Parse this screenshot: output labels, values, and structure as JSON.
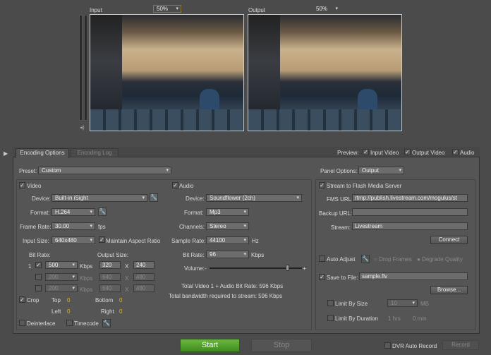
{
  "preview": {
    "input_label": "Input",
    "input_zoom": "50%",
    "output_label": "Output",
    "output_zoom": "50%"
  },
  "tabs": [
    {
      "label": "Encoding Options",
      "active": true
    },
    {
      "label": "Encoding Log",
      "active": false
    }
  ],
  "preview_opts": {
    "label": "Preview:",
    "input_video": "Input Video",
    "output_video": "Output Video",
    "audio": "Audio"
  },
  "preset": {
    "label": "Preset:",
    "value": "Custom"
  },
  "panel_options": {
    "label": "Panel Options:",
    "value": "Output"
  },
  "video": {
    "label": "Video",
    "device_label": "Device:",
    "device": "Built-in iSight",
    "format_label": "Format:",
    "format": "H.264",
    "frame_rate_label": "Frame Rate:",
    "frame_rate": "30.00",
    "fps": "fps",
    "input_size_label": "Input Size:",
    "input_size": "640x480",
    "maintain_aspect": "Maintain Aspect Ratio",
    "bit_rate_label": "Bit Rate:",
    "output_size_label": "Output Size:",
    "rows": [
      {
        "num": "1",
        "rate": "500",
        "unit": "Kbps",
        "w": "320",
        "x": "X",
        "h": "240"
      },
      {
        "rate": "200",
        "unit": "Kbps",
        "w": "640",
        "x": "X",
        "h": "480"
      },
      {
        "rate": "200",
        "unit": "Kbps",
        "w": "640",
        "x": "X",
        "h": "480"
      }
    ],
    "crop": "Crop",
    "top": "Top",
    "top_v": "0",
    "bottom": "Bottom",
    "bottom_v": "0",
    "left": "Left",
    "left_v": "0",
    "right": "Right",
    "right_v": "0",
    "deinterlace": "Deinterlace",
    "timecode": "Timecode"
  },
  "audio": {
    "label": "Audio",
    "device_label": "Device:",
    "device": "Soundflower (2ch)",
    "format_label": "Format:",
    "format": "Mp3",
    "channels_label": "Channels:",
    "channels": "Stereo",
    "sample_rate_label": "Sample Rate:",
    "sample_rate": "44100",
    "hz": "Hz",
    "bit_rate_label": "Bit Rate:",
    "bit_rate": "96",
    "kbps": "Kbps",
    "volume_label": "Volume:",
    "vol_minus": "-",
    "vol_plus": "+",
    "volume": 0.85,
    "total1": "Total Video 1 + Audio Bit Rate: 596 Kbps",
    "total2": "Total bandwidth required to stream: 596 Kbps"
  },
  "output": {
    "stream_fms": "Stream to Flash Media Server",
    "fms_url_label": "FMS URL:",
    "fms_url": "rtmp://publish.livestream.com/mogulus/st",
    "backup_url_label": "Backup URL:",
    "backup_url": "",
    "stream_label": "Stream:",
    "stream": "Livestream",
    "connect": "Connect",
    "auto_adjust": "Auto Adjust",
    "drop_frames": "Drop Frames",
    "degrade_quality": "Degrade Quality",
    "save_to_file": "Save to File:",
    "file": "sample.flv",
    "browse": "Browse...",
    "limit_size": "Limit By Size",
    "size_v": "10",
    "mb": "MB",
    "limit_duration": "Limit By Duration",
    "hrs": "1 hrs",
    "min": "0 min"
  },
  "bottom": {
    "start": "Start",
    "stop": "Stop",
    "dvr": "DVR Auto Record",
    "record": "Record"
  },
  "colors": {
    "start": "#4c9a2a",
    "accent": "#e8b020"
  }
}
